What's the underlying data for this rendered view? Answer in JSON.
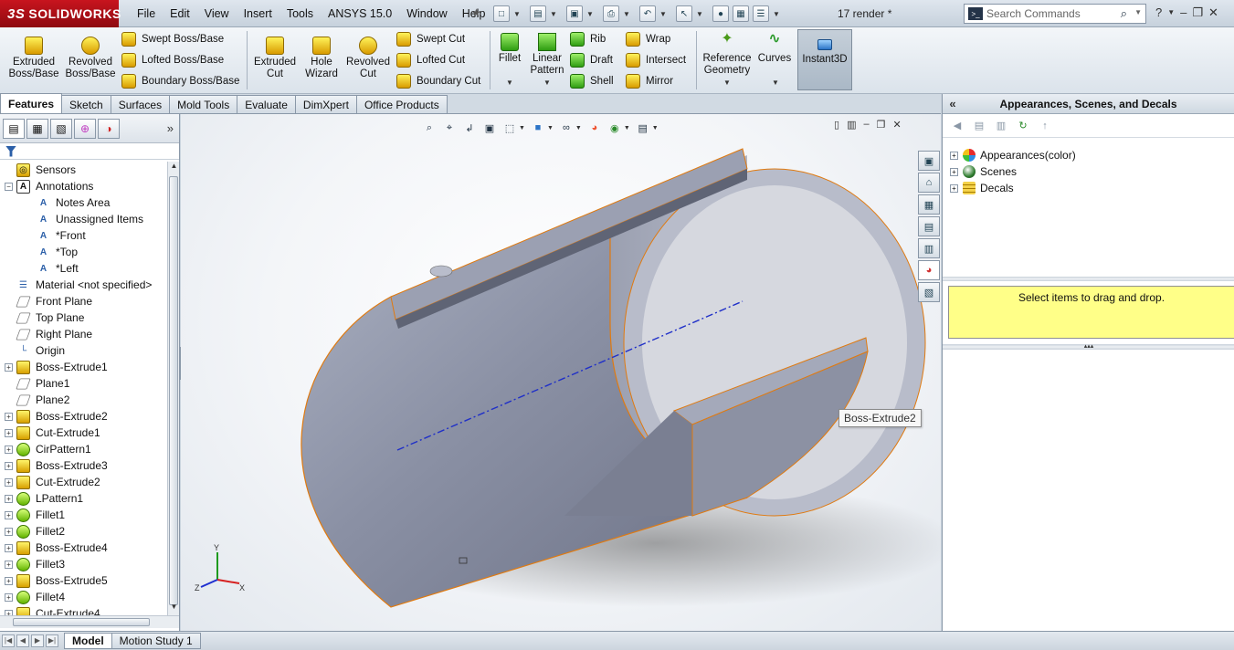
{
  "app": {
    "logo_text": "SOLIDWORKS",
    "logo_mark": "3S",
    "document_title": "17 render *"
  },
  "menu": [
    "File",
    "Edit",
    "View",
    "Insert",
    "Tools",
    "ANSYS 15.0",
    "Window",
    "Help"
  ],
  "search": {
    "placeholder": "Search Commands"
  },
  "toolbar": {
    "extruded_boss": "Extruded Boss/Base",
    "revolved_boss": "Revolved Boss/Base",
    "swept_boss": "Swept Boss/Base",
    "lofted_boss": "Lofted Boss/Base",
    "boundary_boss": "Boundary Boss/Base",
    "extruded_cut": "Extruded Cut",
    "hole_wizard": "Hole Wizard",
    "revolved_cut": "Revolved Cut",
    "swept_cut": "Swept Cut",
    "lofted_cut": "Lofted Cut",
    "boundary_cut": "Boundary Cut",
    "fillet": "Fillet",
    "linear_pattern": "Linear Pattern",
    "rib": "Rib",
    "draft": "Draft",
    "shell": "Shell",
    "wrap": "Wrap",
    "intersect": "Intersect",
    "mirror": "Mirror",
    "reference_geometry": "Reference Geometry",
    "curves": "Curves",
    "instant3d": "Instant3D"
  },
  "tabs": [
    "Features",
    "Sketch",
    "Surfaces",
    "Mold Tools",
    "Evaluate",
    "DimXpert",
    "Office Products"
  ],
  "feature_tree": [
    {
      "label": "Sensors",
      "icon": "sensor-icon",
      "expandable": false,
      "indent": 0
    },
    {
      "label": "Annotations",
      "icon": "annotation-icon",
      "expandable": true,
      "indent": 0
    },
    {
      "label": "Notes Area",
      "icon": "notes-icon",
      "expandable": false,
      "indent": 1
    },
    {
      "label": "Unassigned Items",
      "icon": "notes-icon",
      "expandable": false,
      "indent": 1
    },
    {
      "label": "*Front",
      "icon": "view-icon",
      "expandable": false,
      "indent": 1
    },
    {
      "label": "*Top",
      "icon": "view-icon",
      "expandable": false,
      "indent": 1
    },
    {
      "label": "*Left",
      "icon": "view-icon",
      "expandable": false,
      "indent": 1
    },
    {
      "label": "Material <not specified>",
      "icon": "material-icon",
      "expandable": false,
      "indent": 0
    },
    {
      "label": "Front Plane",
      "icon": "plane-icon",
      "expandable": false,
      "indent": 0
    },
    {
      "label": "Top Plane",
      "icon": "plane-icon",
      "expandable": false,
      "indent": 0
    },
    {
      "label": "Right Plane",
      "icon": "plane-icon",
      "expandable": false,
      "indent": 0
    },
    {
      "label": "Origin",
      "icon": "origin-icon",
      "expandable": false,
      "indent": 0
    },
    {
      "label": "Boss-Extrude1",
      "icon": "extrude-icon",
      "expandable": true,
      "indent": 0
    },
    {
      "label": "Plane1",
      "icon": "plane-icon",
      "expandable": false,
      "indent": 0
    },
    {
      "label": "Plane2",
      "icon": "plane-icon",
      "expandable": false,
      "indent": 0
    },
    {
      "label": "Boss-Extrude2",
      "icon": "extrude-icon",
      "expandable": true,
      "indent": 0
    },
    {
      "label": "Cut-Extrude1",
      "icon": "extrude-icon",
      "expandable": true,
      "indent": 0
    },
    {
      "label": "CirPattern1",
      "icon": "pattern-icon",
      "expandable": true,
      "indent": 0
    },
    {
      "label": "Boss-Extrude3",
      "icon": "extrude-icon",
      "expandable": true,
      "indent": 0
    },
    {
      "label": "Cut-Extrude2",
      "icon": "extrude-icon",
      "expandable": true,
      "indent": 0
    },
    {
      "label": "LPattern1",
      "icon": "pattern-icon",
      "expandable": true,
      "indent": 0
    },
    {
      "label": "Fillet1",
      "icon": "fillet-icon",
      "expandable": true,
      "indent": 0
    },
    {
      "label": "Fillet2",
      "icon": "fillet-icon",
      "expandable": true,
      "indent": 0
    },
    {
      "label": "Boss-Extrude4",
      "icon": "extrude-icon",
      "expandable": true,
      "indent": 0
    },
    {
      "label": "Fillet3",
      "icon": "fillet-icon",
      "expandable": true,
      "indent": 0
    },
    {
      "label": "Boss-Extrude5",
      "icon": "extrude-icon",
      "expandable": true,
      "indent": 0
    },
    {
      "label": "Fillet4",
      "icon": "fillet-icon",
      "expandable": true,
      "indent": 0
    },
    {
      "label": "Cut-Extrude4",
      "icon": "extrude-icon",
      "expandable": true,
      "indent": 0
    }
  ],
  "viewport": {
    "tooltip": "Boss-Extrude2",
    "triad": {
      "x": "X",
      "y": "Y",
      "z": "Z"
    }
  },
  "task_pane": {
    "title": "Appearances, Scenes, and Decals",
    "items": [
      "Appearances(color)",
      "Scenes",
      "Decals"
    ],
    "drop_hint": "Select items to drag and drop."
  },
  "bottom_tabs": [
    "Model",
    "Motion Study 1"
  ],
  "colors": {
    "accent_red": "#c8141e",
    "part_body": "#8d91a3",
    "edge_highlight": "#e07a10",
    "drop_hint_bg": "#ffff88"
  }
}
